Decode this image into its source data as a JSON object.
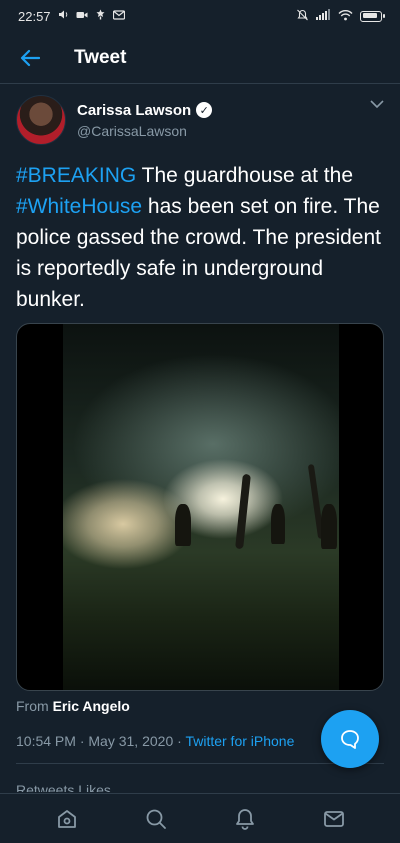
{
  "status_bar": {
    "time": "22:57",
    "left_icons": [
      "volume-icon",
      "video-icon",
      "notification-icon",
      "mail-icon"
    ],
    "right_icons": [
      "mute-icon",
      "signal-icon",
      "wifi-icon",
      "battery-icon"
    ]
  },
  "header": {
    "title": "Tweet"
  },
  "tweet": {
    "author": {
      "display_name": "Carissa Lawson",
      "handle": "@CarissaLawson",
      "verified": true
    },
    "text_parts": {
      "hashtag_1": "#BREAKING",
      "text_1": " The guardhouse at the ",
      "hashtag_2": "#WhiteHouse",
      "text_2": " has been set on fire. The police gassed the crowd. The president is reportedly safe in underground bunker."
    },
    "from_label": "From ",
    "from_name": "Eric Angelo",
    "time": "10:54 PM",
    "separator": " · ",
    "date": "May 31, 2020",
    "source": "Twitter for iPhone",
    "stats_partial": "Retweets   Likes"
  },
  "colors": {
    "background": "#15202b",
    "accent": "#1da1f2",
    "muted": "#8899a6",
    "divider": "#2f3d4a"
  },
  "nav": {
    "tabs": [
      "home-icon",
      "search-icon",
      "notifications-icon",
      "messages-icon"
    ]
  },
  "fab": {
    "icon": "compose-reply-icon"
  }
}
